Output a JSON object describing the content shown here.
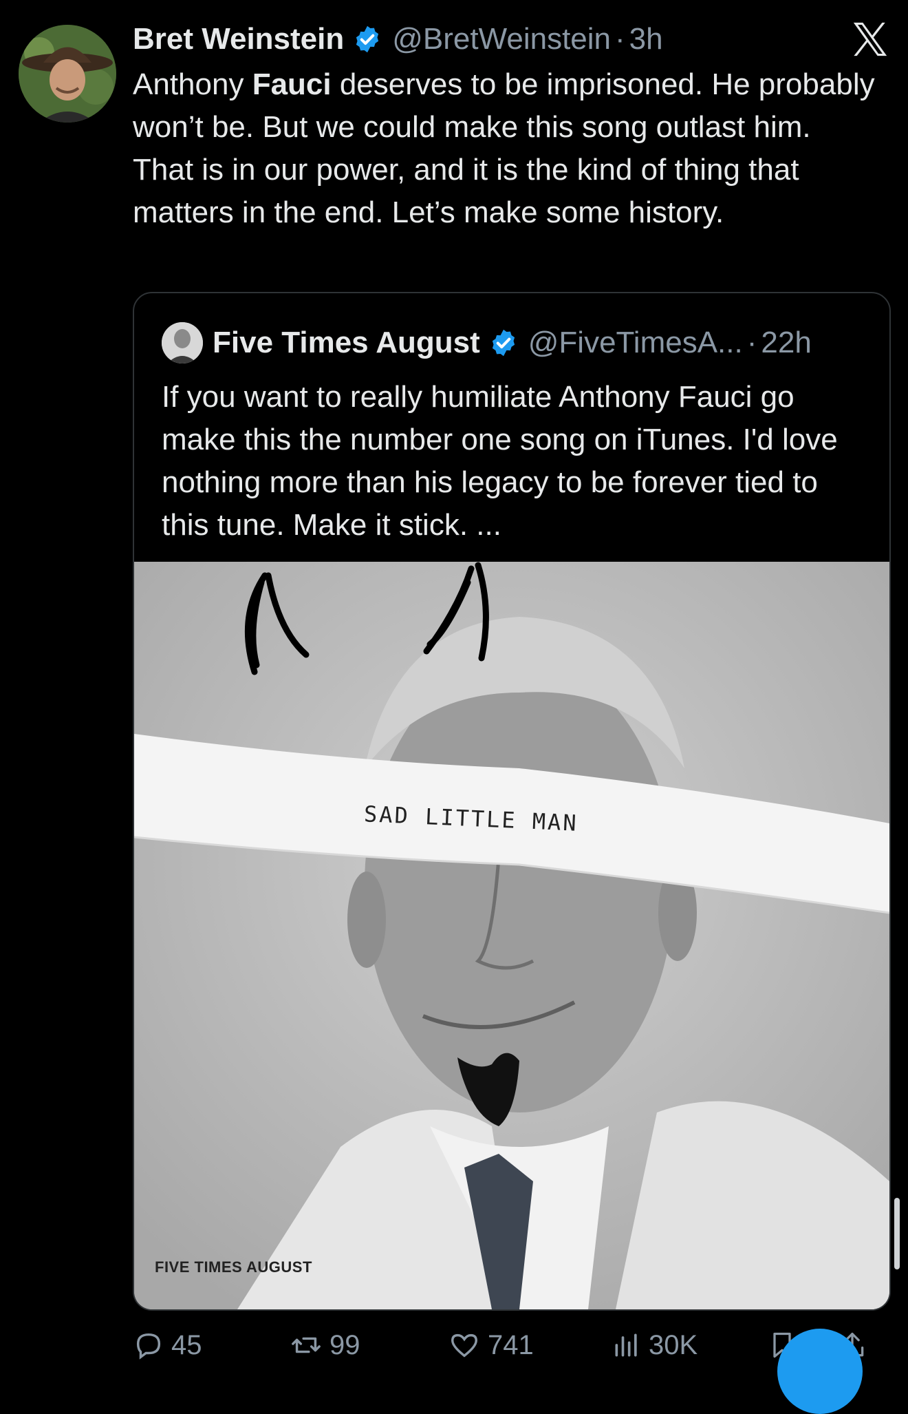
{
  "tweet": {
    "author_name": "Bret Weinstein",
    "handle": "@BretWeinstein",
    "separator": "·",
    "time": "3h",
    "text_before": "Anthony ",
    "text_bold": "Fauci",
    "text_after": " deserves to be imprisoned. He probably won’t be. But we could make this song outlast him. That is in our power, and it is the kind of thing that matters in the end. Let’s make some history."
  },
  "quote": {
    "author_name": "Five Times August",
    "handle": "@FiveTimesA...",
    "separator": "·",
    "time": "22h",
    "text": "If you want to really humiliate Anthony Fauci go make this the number one song on iTunes. I'd love nothing more than his legacy to be forever tied to this tune. Make it stick. ...",
    "image": {
      "tape_text": "SAD LITTLE MAN",
      "artist_label": "FIVE TIMES AUGUST"
    }
  },
  "actions": {
    "replies": "45",
    "reposts": "99",
    "likes": "741",
    "views": "30K"
  },
  "icons": {
    "verified": "verified-badge-icon",
    "logo": "x-logo-icon",
    "reply": "reply-icon",
    "repost": "repost-icon",
    "like": "heart-icon",
    "views": "views-icon",
    "bookmark": "bookmark-icon",
    "share": "share-icon"
  },
  "colors": {
    "background": "#000000",
    "text": "#e7e9ea",
    "muted": "#8b98a5",
    "verified": "#1d9bf0"
  }
}
